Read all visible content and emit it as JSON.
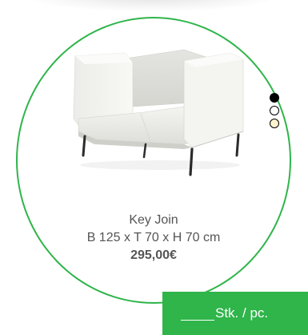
{
  "product": {
    "name": "Key Join",
    "dimensions": "B 125 x T 70 x H 70 cm",
    "price": "295,00€",
    "image_icon": "sofa-image"
  },
  "colors": {
    "accent": "#2fb54a",
    "swatches": [
      {
        "name": "black",
        "hex": "#000000",
        "selected": true
      },
      {
        "name": "white",
        "hex": "#ffffff",
        "selected": false
      },
      {
        "name": "cream",
        "hex": "#fff3cf",
        "selected": false
      }
    ]
  },
  "quantity": {
    "unit_label": "Stk. / pc.",
    "value": ""
  }
}
